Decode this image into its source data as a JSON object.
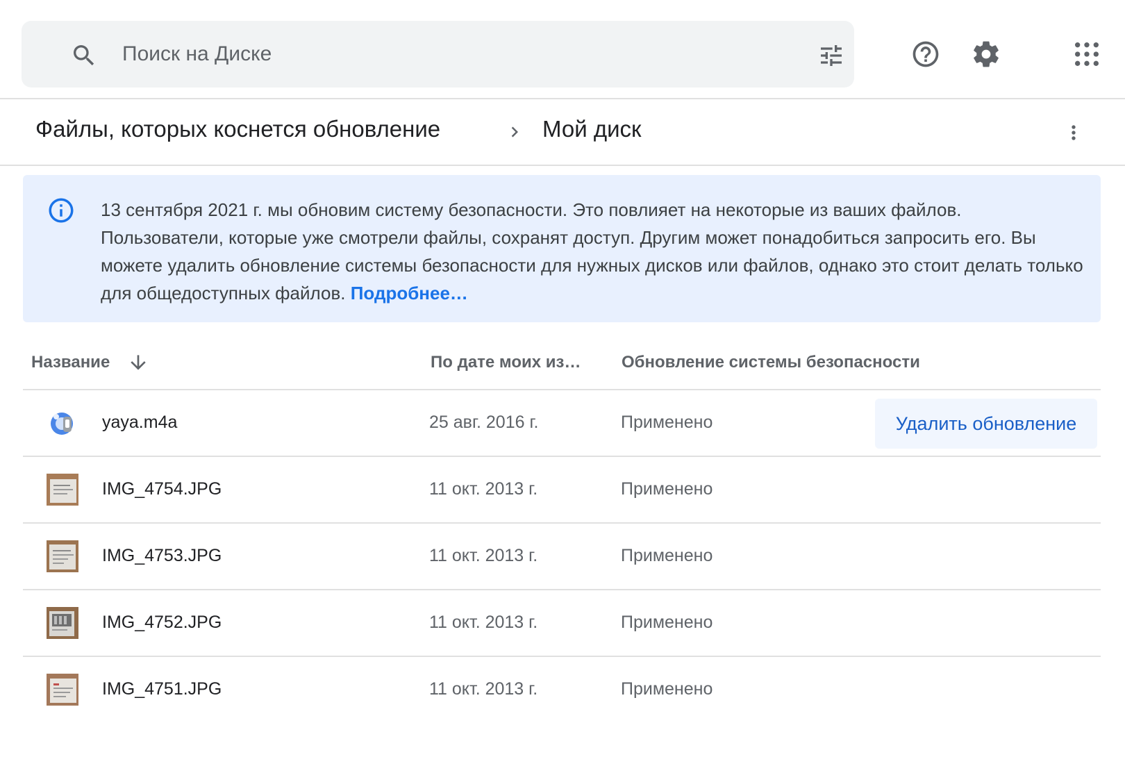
{
  "search": {
    "placeholder": "Поиск на Диске"
  },
  "breadcrumb": {
    "items": [
      "Файлы, которых коснется обновление",
      "Мой диск"
    ]
  },
  "banner": {
    "text": "13 сентября 2021 г. мы обновим систему безопасности. Это повлияет на некоторые из ваших файлов. Пользователи, которые уже смотрели файлы, сохранят доступ. Другим может понадобиться запросить его. Вы можете удалить обновление системы безопасности для нужных дисков или файлов, однако это стоит делать только для общедоступных файлов.",
    "link": "Подробнее…"
  },
  "table": {
    "headers": {
      "name": "Название",
      "date": "По дате моих из…",
      "security": "Обновление системы безопасности"
    },
    "rows": [
      {
        "name": "yaya.m4a",
        "date": "25 авг. 2016 г.",
        "status": "Применено",
        "icon": "audio-file-icon",
        "action": "Удалить обновление"
      },
      {
        "name": "IMG_4754.JPG",
        "date": "11 окт. 2013 г.",
        "status": "Применено",
        "icon": "image-thumbnail"
      },
      {
        "name": "IMG_4753.JPG",
        "date": "11 окт. 2013 г.",
        "status": "Применено",
        "icon": "image-thumbnail"
      },
      {
        "name": "IMG_4752.JPG",
        "date": "11 окт. 2013 г.",
        "status": "Применено",
        "icon": "image-thumbnail"
      },
      {
        "name": "IMG_4751.JPG",
        "date": "11 окт. 2013 г.",
        "status": "Применено",
        "icon": "image-thumbnail"
      }
    ]
  },
  "colors": {
    "accent": "#1a73e8",
    "banner_bg": "#e8f0fe",
    "search_bg": "#f1f3f4",
    "divider": "#e0e0e0"
  }
}
